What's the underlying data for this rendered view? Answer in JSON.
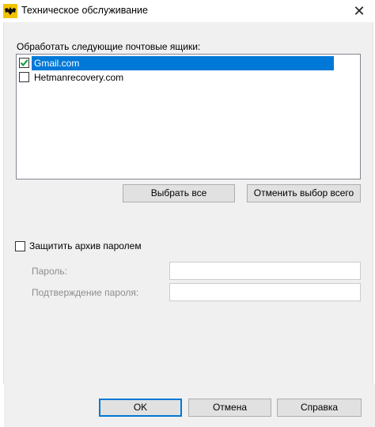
{
  "window": {
    "title": "Техническое обслуживание",
    "icon": "batman-app-icon",
    "close_glyph": "✕"
  },
  "mailboxes": {
    "label": "Обработать следующие почтовые ящики:",
    "items": [
      {
        "label": "Gmail.com",
        "checked": true,
        "selected": true
      },
      {
        "label": "Hetmanrecovery.com",
        "checked": false,
        "selected": false
      }
    ],
    "select_all_label": "Выбрать все",
    "deselect_all_label": "Отменить выбор всего"
  },
  "protect": {
    "label": "Защитить архив паролем",
    "checked": false,
    "password_label": "Пароль:",
    "password_value": "",
    "confirm_label": "Подтверждение пароля:",
    "confirm_value": ""
  },
  "footer": {
    "ok_label": "OK",
    "cancel_label": "Отмена",
    "help_label": "Справка"
  },
  "colors": {
    "selection": "#0078d7",
    "check": "#1a9e3c",
    "dialog_bg": "#f0f0f0"
  }
}
